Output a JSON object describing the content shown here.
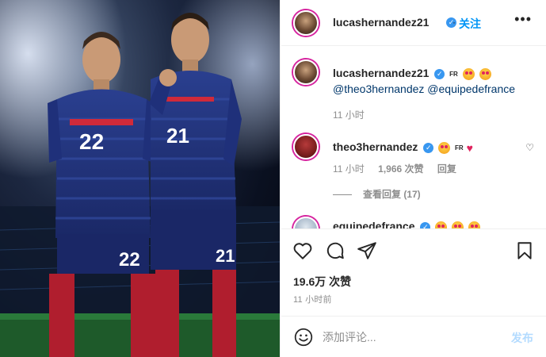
{
  "post": {
    "author": "lucashernandez21",
    "follow_label": "关注",
    "more_icon": "more-options-icon",
    "accent": "#0095f6"
  },
  "caption": {
    "username": "lucashernandez21",
    "flag_text": "FR",
    "mentions": "@theo3hernandez @equipedefrance",
    "time": "11 小时"
  },
  "comments": [
    {
      "username": "theo3hernandez",
      "flag_text": "FR",
      "time": "11 小时",
      "likes": "1,966 次赞",
      "reply_label": "回复",
      "view_replies": "查看回复 (17)"
    },
    {
      "username": "equipedefrance"
    }
  ],
  "actions": {
    "likes": "19.6万 次赞",
    "posted": "11 小时前"
  },
  "comment_box": {
    "placeholder": "添加评论...",
    "post_label": "发布"
  },
  "jersey_numbers": [
    "22",
    "21"
  ]
}
